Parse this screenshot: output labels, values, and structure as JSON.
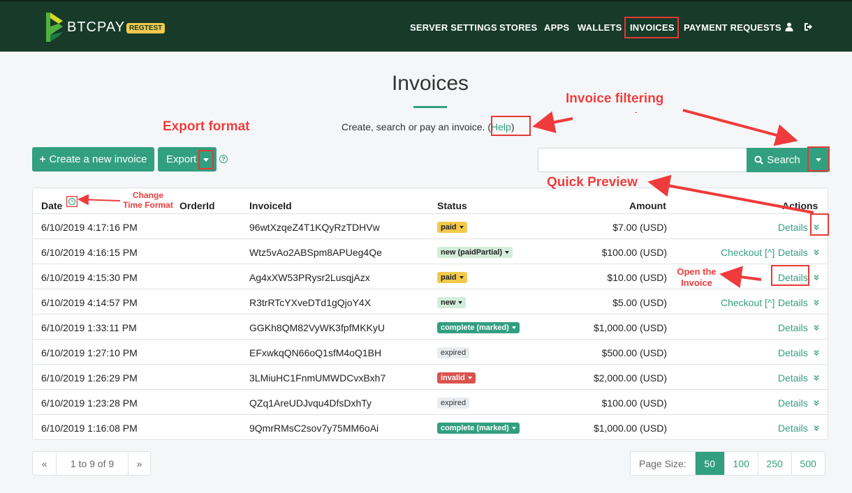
{
  "nav": {
    "brand": "BTCPAY",
    "badge": "REGTEST",
    "items": [
      {
        "label": "SERVER SETTINGS"
      },
      {
        "label": "STORES"
      },
      {
        "label": "APPS"
      },
      {
        "label": "WALLETS"
      },
      {
        "label": "INVOICES"
      },
      {
        "label": "PAYMENT REQUESTS"
      }
    ],
    "icons": [
      "user-icon",
      "logout-icon"
    ]
  },
  "page": {
    "title": "Invoices",
    "lead": "Create, search or pay an invoice.",
    "help_open": "(",
    "help_link": "Help",
    "help_close": ")"
  },
  "toolbar": {
    "create_label": "Create a new invoice",
    "export_label": "Export",
    "search_placeholder": "",
    "search_label": "Search"
  },
  "table": {
    "headers": {
      "date": "Date",
      "order": "OrderId",
      "invoice": "InvoiceId",
      "status": "Status",
      "amount": "Amount",
      "actions": "Actions"
    },
    "rows": [
      {
        "date": "6/10/2019 4:17:16 PM",
        "invoice": "96wtXzqeZ4T1KQyRzTDHVw",
        "status": "paid",
        "dropdown": true,
        "amount": "$7.00 (USD)",
        "checkout": "",
        "details": "Details"
      },
      {
        "date": "6/10/2019 4:16:15 PM",
        "invoice": "Wtz5vAo2ABSpm8APUeg4Qe",
        "status": "new (paidPartial)",
        "dropdown": true,
        "amount": "$100.00 (USD)",
        "checkout": "Checkout [^]",
        "details": "Details"
      },
      {
        "date": "6/10/2019 4:15:30 PM",
        "invoice": "Ag4xXW53PRysr2LusqjAzx",
        "status": "paid",
        "dropdown": true,
        "amount": "$10.00 (USD)",
        "checkout": "",
        "details": "Details"
      },
      {
        "date": "6/10/2019 4:14:57 PM",
        "invoice": "R3trRTcYXveDTd1gQjoY4X",
        "status": "new",
        "dropdown": true,
        "amount": "$5.00 (USD)",
        "checkout": "Checkout [^]",
        "details": "Details"
      },
      {
        "date": "6/10/2019 1:33:11 PM",
        "invoice": "GGKh8QM82VyWK3fpfMKKyU",
        "status": "complete (marked)",
        "dropdown": true,
        "amount": "$1,000.00 (USD)",
        "checkout": "",
        "details": "Details"
      },
      {
        "date": "6/10/2019 1:27:10 PM",
        "invoice": "EFxwkqQN66oQ1sfM4oQ1BH",
        "status": "expired",
        "dropdown": false,
        "amount": "$500.00 (USD)",
        "checkout": "",
        "details": "Details"
      },
      {
        "date": "6/10/2019 1:26:29 PM",
        "invoice": "3LMiuHC1FnmUMWDCvxBxh7",
        "status": "invalid",
        "dropdown": true,
        "amount": "$2,000.00 (USD)",
        "checkout": "",
        "details": "Details"
      },
      {
        "date": "6/10/2019 1:23:28 PM",
        "invoice": "QZq1AreUDJvqu4DfsDxhTy",
        "status": "expired",
        "dropdown": false,
        "amount": "$100.00 (USD)",
        "checkout": "",
        "details": "Details"
      },
      {
        "date": "6/10/2019 1:16:08 PM",
        "invoice": "9QmrRMsC2sov7y75MM6oAi",
        "status": "complete (marked)",
        "dropdown": true,
        "amount": "$1,000.00 (USD)",
        "checkout": "",
        "details": "Details"
      }
    ]
  },
  "pagination": {
    "prev": "«",
    "range": "1 to 9 of 9",
    "next": "»",
    "size_label": "Page Size:",
    "sizes": [
      "50",
      "100",
      "250",
      "500"
    ],
    "active_size": "50"
  },
  "annotations": {
    "export_format": "Export format",
    "invoice_filtering": "Invoice filtering",
    "quick_preview": "Quick Preview",
    "change_time_1": "Change",
    "change_time_2": "Time Format",
    "open_invoice_1": "Open the",
    "open_invoice_2": "Invoice",
    "dash": "-"
  },
  "colors": {
    "navbar": "#173a29",
    "accent": "#329f80",
    "annotation": "#e53935",
    "paid": "#f2c94c",
    "invalid": "#d9534f"
  }
}
